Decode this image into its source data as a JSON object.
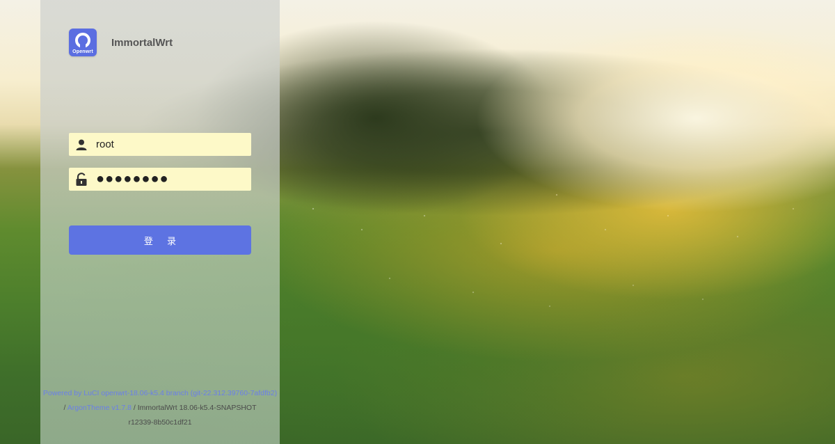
{
  "brand": {
    "logo_text": "Openwrt",
    "name": "ImmortalWrt",
    "accent_color": "#5b6ee1"
  },
  "login_form": {
    "username": {
      "icon": "user-icon",
      "value": "root"
    },
    "password": {
      "icon": "unlock-icon",
      "value": "●●●●●●●●"
    },
    "submit_label": "登 录",
    "button_color": "#5d73e2",
    "field_color": "#fdf9c8"
  },
  "footer": {
    "powered_by_link": "Powered by LuCI openwrt-18.06-k5.4 branch (git-22.312.39760-7afdfb2)",
    "separator_1": "/",
    "theme_link": "ArgonTheme v1.7.8",
    "separator_2": "/",
    "firmware": "ImmortalWrt 18.06-k5.4-SNAPSHOT",
    "revision": "r12339-8b50c1df21",
    "link_color": "#6a7fe8"
  }
}
